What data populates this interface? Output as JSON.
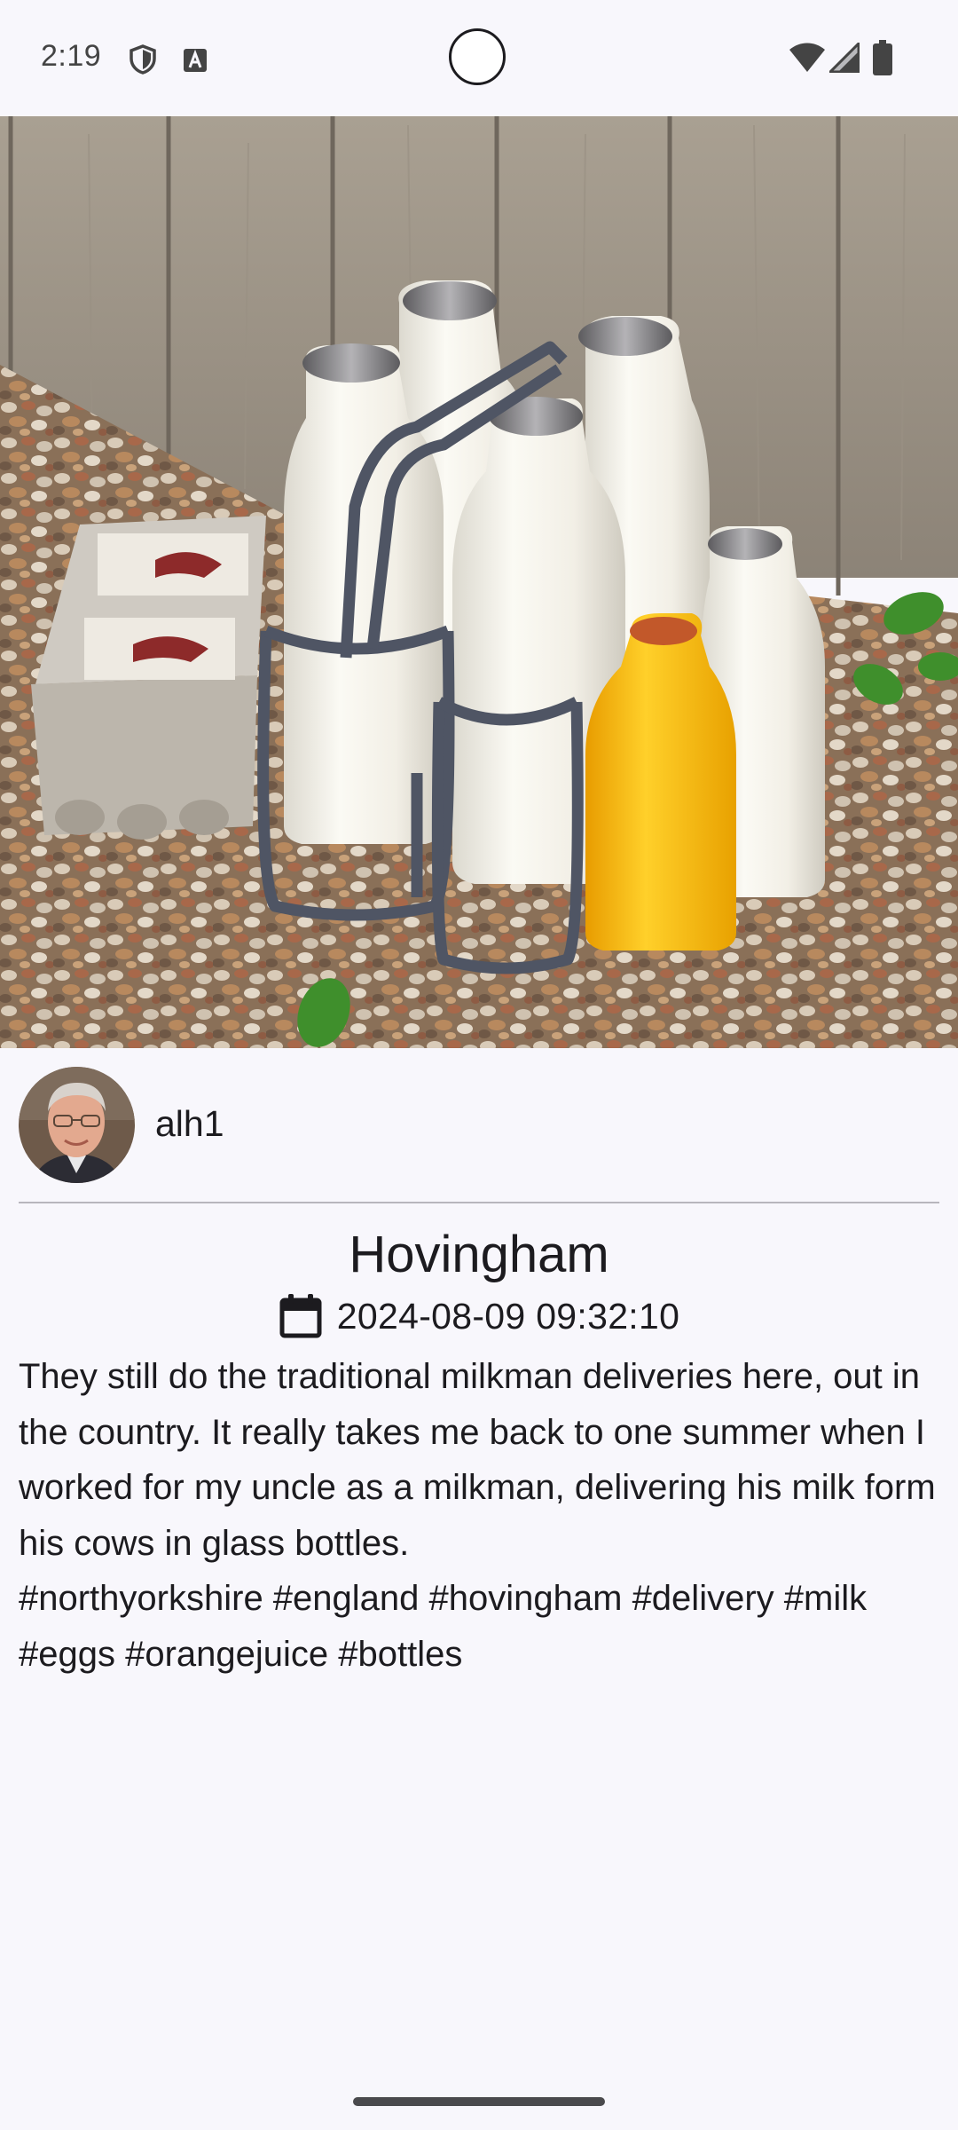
{
  "status_bar": {
    "time": "2:19",
    "icons": [
      "shield-icon",
      "text-a-icon",
      "camera-cutout",
      "wifi-icon",
      "signal-icon",
      "battery-icon"
    ]
  },
  "post": {
    "image_icon": "milk-bottles-photo",
    "author": {
      "username": "alh1",
      "avatar_icon": "user-avatar"
    },
    "title": "Hovingham",
    "date_icon": "calendar-icon",
    "date": "2024-08-09 09:32:10",
    "body": "They still do the traditional milkman deliveries here, out in the country. It really takes me back to one summer when I worked for my uncle as a milkman, delivering his milk form his cows in glass bottles.\n#northyorkshire #england #hovingham #delivery #milk #eggs #orangejuice #bottles"
  },
  "colors": {
    "background": "#f8f7fc",
    "text": "#1c1b1f",
    "divider": "#b8b6bd",
    "orange_juice": "#f7b500"
  }
}
